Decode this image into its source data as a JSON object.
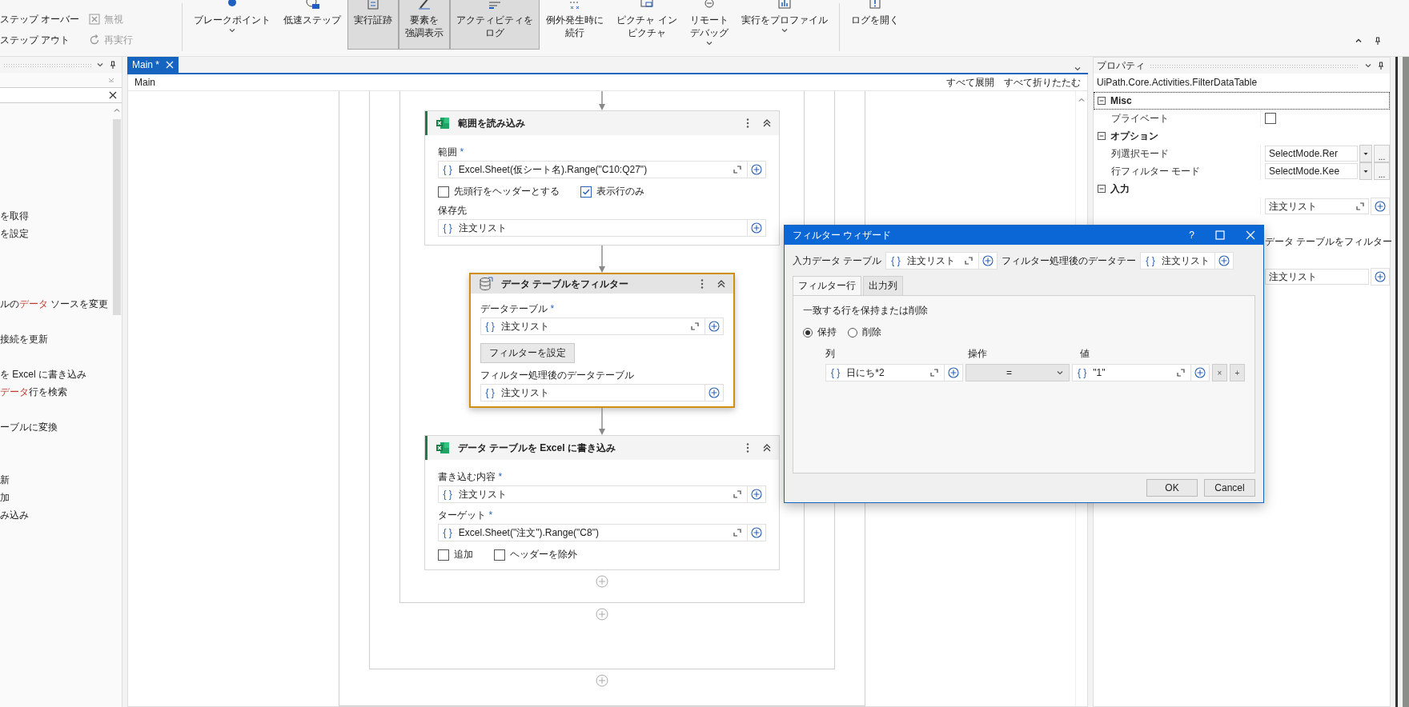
{
  "ribbon": {
    "small_columns": [
      [
        {
          "label": "ステップ オーバー",
          "kind": "none",
          "disabled": false
        },
        {
          "label": "ステップ アウト",
          "kind": "none",
          "disabled": false
        }
      ],
      [
        {
          "label": "無視",
          "kind": "ignore",
          "disabled": true
        },
        {
          "label": "再実行",
          "kind": "restart",
          "disabled": true
        }
      ]
    ],
    "button_groups": [
      [
        {
          "lines": [
            "ブレークポイント"
          ],
          "kind": "breakpoint",
          "dropdown": true,
          "selected": false
        },
        {
          "lines": [
            "低速ステップ"
          ],
          "kind": "slow-step",
          "dropdown": false,
          "selected": false
        },
        {
          "lines": [
            "実行証跡"
          ],
          "kind": "trace",
          "dropdown": false,
          "selected": true
        },
        {
          "lines": [
            "要素を",
            "強調表示"
          ],
          "kind": "highlight",
          "dropdown": false,
          "selected": true
        },
        {
          "lines": [
            "アクティビティを",
            "ログ"
          ],
          "kind": "log",
          "dropdown": false,
          "selected": true
        },
        {
          "lines": [
            "例外発生時に",
            "続行"
          ],
          "kind": "continue",
          "dropdown": false,
          "selected": false
        },
        {
          "lines": [
            "ピクチャ イン",
            "ピクチャ"
          ],
          "kind": "pip",
          "dropdown": false,
          "selected": false
        },
        {
          "lines": [
            "リモート",
            "デバッグ"
          ],
          "kind": "remote",
          "dropdown": true,
          "selected": false
        },
        {
          "lines": [
            "実行をプロファイル"
          ],
          "kind": "profile",
          "dropdown": true,
          "selected": false
        }
      ],
      [
        {
          "lines": [
            "ログを開く"
          ],
          "kind": "open-log",
          "dropdown": false,
          "selected": false
        }
      ]
    ]
  },
  "left_panel": {
    "items": [
      {
        "kind": "line",
        "text": "を取得"
      },
      {
        "kind": "line",
        "text": "を設定"
      },
      {
        "kind": "blank"
      },
      {
        "kind": "blank"
      },
      {
        "kind": "blank"
      },
      {
        "kind": "line",
        "text": "ルの**データ** ソースを変更"
      },
      {
        "kind": "blank"
      },
      {
        "kind": "line",
        "text": "接続を更新"
      },
      {
        "kind": "blank"
      },
      {
        "kind": "line",
        "text": "を Excel に書き込み"
      },
      {
        "kind": "line",
        "text": "**データ**行を検索"
      },
      {
        "kind": "blank"
      },
      {
        "kind": "line",
        "text": "ーブルに変換"
      },
      {
        "kind": "blank"
      },
      {
        "kind": "blank"
      },
      {
        "kind": "line",
        "text": "新"
      },
      {
        "kind": "line",
        "text": "加"
      },
      {
        "kind": "line",
        "text": "み込み"
      }
    ]
  },
  "editor": {
    "tab": {
      "label": "Main *",
      "selected": true
    },
    "breadcrumb": "Main",
    "actions": [
      "すべて展開",
      "すべて折りたたむ"
    ],
    "activities": [
      {
        "kind": "excel",
        "title": "範囲を読み込み",
        "selected": false,
        "sections": [
          {
            "kind": "field",
            "label": "範囲",
            "required_mark": "*",
            "field": {
              "prefix": "{ }",
              "value": "Excel.Sheet(仮シート名).Range(\"C10:Q27\")",
              "expandable": true
            }
          },
          {
            "kind": "checkboxes",
            "items": [
              {
                "label": "先頭行をヘッダーとする",
                "checked": false
              },
              {
                "label": "表示行のみ",
                "checked": true
              }
            ]
          },
          {
            "kind": "field",
            "label": "保存先",
            "field": {
              "prefix": "{ }",
              "value": "注文リスト",
              "expandable": false
            }
          }
        ]
      },
      {
        "kind": "datatable",
        "title": "データ テーブルをフィルター",
        "selected": true,
        "sections": [
          {
            "kind": "field",
            "label": "データテーブル",
            "required_mark": "*",
            "field": {
              "prefix": "{ }",
              "value": "注文リスト",
              "expandable": true
            }
          },
          {
            "kind": "button",
            "label": "フィルターを設定"
          },
          {
            "kind": "field",
            "label": "フィルター処理後のデータテーブル",
            "field": {
              "prefix": "{ }",
              "value": "注文リスト",
              "expandable": false
            }
          }
        ]
      },
      {
        "kind": "excel",
        "title": "データ テーブルを Excel に書き込み",
        "selected": false,
        "sections": [
          {
            "kind": "field",
            "label": "書き込む内容",
            "required_mark": "*",
            "field": {
              "prefix": "{ }",
              "value": "注文リスト",
              "expandable": true
            }
          },
          {
            "kind": "field",
            "label": "ターゲット",
            "required_mark": "*",
            "field": {
              "prefix": "{ }",
              "value": "Excel.Sheet(\"注文\").Range(\"C8\")",
              "expandable": true
            }
          },
          {
            "kind": "checkboxes",
            "items": [
              {
                "label": "追加",
                "checked": false
              },
              {
                "label": "ヘッダーを除外",
                "checked": false
              }
            ]
          }
        ]
      }
    ]
  },
  "properties": {
    "title": "プロパティ",
    "type_name": "UiPath.Core.Activities.FilterDataTable",
    "rows": [
      {
        "kind": "category",
        "name": "Misc",
        "expanded": true,
        "focused": true
      },
      {
        "kind": "checkbox",
        "name": "プライベート",
        "checked": false
      },
      {
        "kind": "category",
        "name": "オプション",
        "expanded": true,
        "focused": false
      },
      {
        "kind": "dropdown",
        "name": "列選択モード",
        "value": "SelectMode.Rer",
        "button": "..."
      },
      {
        "kind": "dropdown",
        "name": "行フィルター モード",
        "value": "SelectMode.Kee",
        "button": "..."
      },
      {
        "kind": "category",
        "name": "入力",
        "expanded": true,
        "focused": false
      },
      {
        "kind": "field",
        "value": "注文リスト",
        "expandable": true
      },
      {
        "kind": "category"
      },
      {
        "kind": "text",
        "value": "データ テーブルをフィルター"
      },
      {
        "kind": "category"
      },
      {
        "kind": "field",
        "value": "注文リスト",
        "expandable": false
      }
    ]
  },
  "dialog": {
    "title": "フィルター ウィザード",
    "help": "?",
    "input_label": "入力データ テーブル",
    "input": {
      "prefix": "{ }",
      "value": "注文リスト",
      "expandable": true
    },
    "output_label": "フィルター処理後のデータテー",
    "output": {
      "prefix": "{ }",
      "value": "注文リスト",
      "expandable": false
    },
    "tabs": [
      {
        "label": "フィルター行",
        "selected": true
      },
      {
        "label": "出力列",
        "selected": false
      }
    ],
    "mode_label": "一致する行を保持または削除",
    "modes": [
      {
        "label": "保持",
        "selected": true
      },
      {
        "label": "削除",
        "selected": false
      }
    ],
    "columns": [
      "列",
      "操作",
      "値"
    ],
    "rules": [
      {
        "column": {
          "prefix": "{ }",
          "value": "日にち*2",
          "expandable": true
        },
        "operation": "=",
        "value": {
          "prefix": "{ }",
          "value": "\"1\"",
          "expandable": true
        },
        "remove": "×",
        "add": "+"
      }
    ],
    "buttons": [
      "OK",
      "Cancel"
    ]
  }
}
